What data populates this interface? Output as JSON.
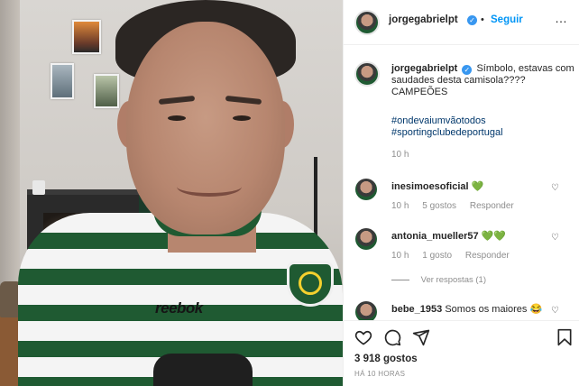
{
  "post": {
    "author": "jorgegabrielpt",
    "follow_label": "Seguir",
    "dot": "•",
    "more": "…",
    "verified_mark": "✓",
    "caption_text": "Símbolo, estavas com saudades desta camisola???? CAMPEÕES",
    "hashtags": [
      "#ondevaiumvãotodos",
      "#sportingclubedeportugal"
    ],
    "caption_time": "10 h",
    "likes": "3 918 gostos",
    "posted_ago": "HÁ 10 HORAS",
    "photo_jersey_text": "reebok"
  },
  "comments": [
    {
      "user": "inesimoesoficial",
      "text": "💚",
      "time": "10 h",
      "likes": "5 gostos",
      "reply": "Responder"
    },
    {
      "user": "antonia_mueller57",
      "text": "💚💚",
      "time": "10 h",
      "likes": "1 gosto",
      "reply": "Responder",
      "view_replies": "Ver respostas (1)"
    },
    {
      "user": "bebe_1953",
      "text": "Somos os maiores 😂"
    }
  ],
  "icons": {
    "like": "heart-icon",
    "comment": "comment-icon",
    "share": "paper-plane-icon",
    "save": "bookmark-icon"
  },
  "colors": {
    "link": "#0095f6",
    "hashtag": "#00376b",
    "meta": "#8e8e8e",
    "verified": "#3897f0"
  }
}
